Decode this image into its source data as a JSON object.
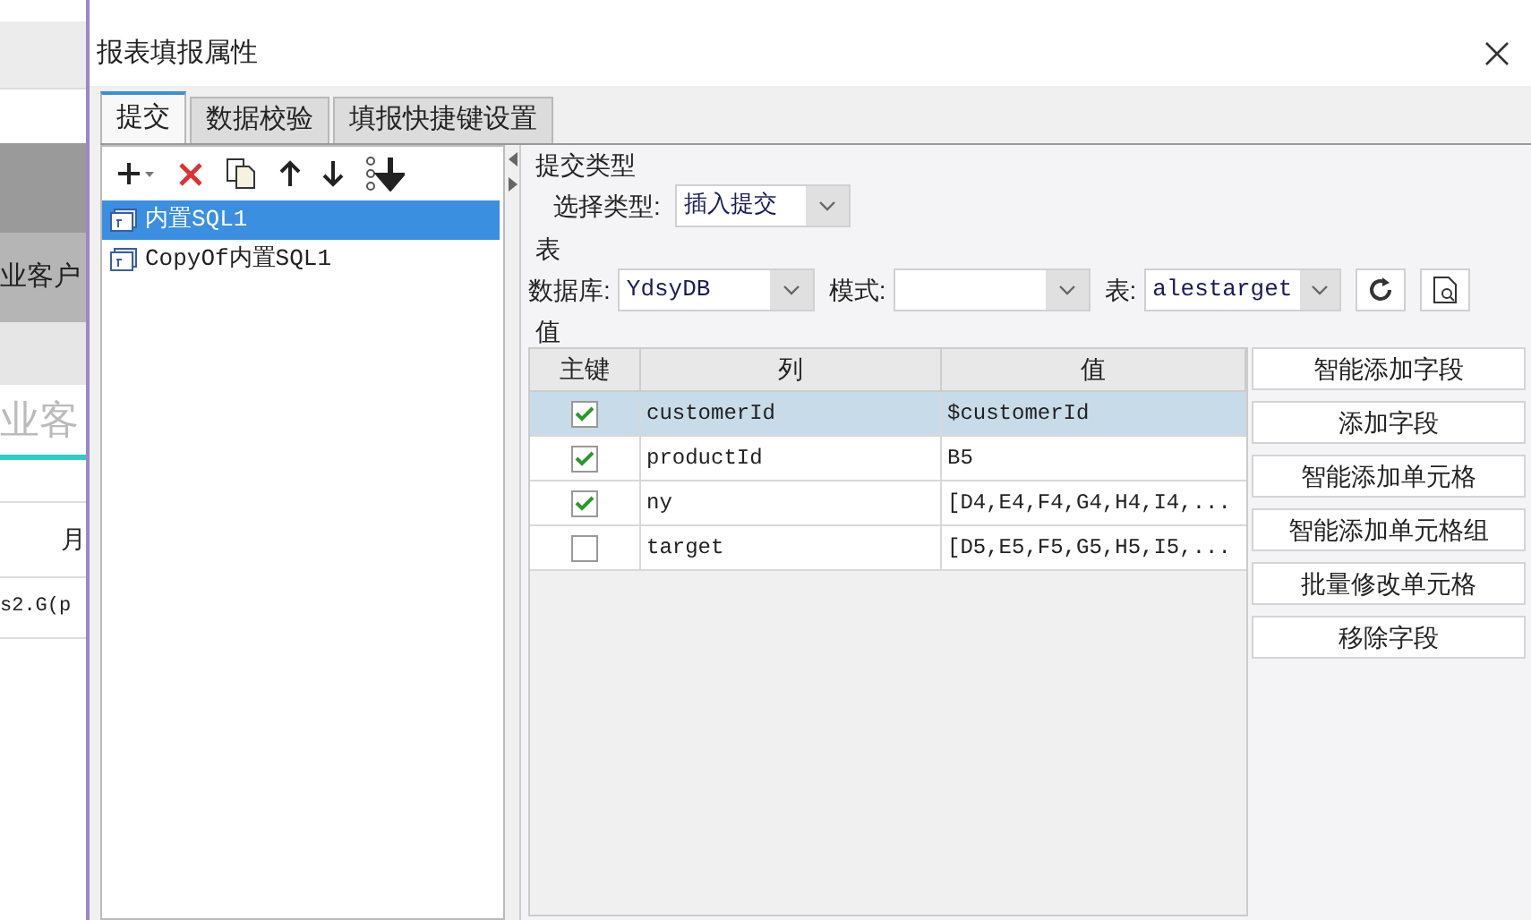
{
  "background": {
    "texts": [
      "业客户",
      "业客",
      "月",
      "s2.G(p"
    ]
  },
  "window": {
    "title": "报表填报属性"
  },
  "tabs": [
    {
      "label": "提交",
      "selected": true
    },
    {
      "label": "数据校验",
      "selected": false
    },
    {
      "label": "填报快捷键设置",
      "selected": false
    }
  ],
  "submissions": [
    {
      "label": "内置SQL1",
      "selected": true
    },
    {
      "label": "CopyOf内置SQL1",
      "selected": false
    }
  ],
  "submit_type": {
    "section": "提交类型",
    "label": "选择类型:",
    "value": "插入提交"
  },
  "table_section": {
    "section": "表",
    "database_label": "数据库:",
    "database": "YdsyDB",
    "schema_label": "模式:",
    "table_label": "表:",
    "table": "alestarget"
  },
  "values_section": {
    "section": "值",
    "columns": [
      "主键",
      "列",
      "值"
    ],
    "rows": [
      {
        "key": true,
        "column": "customerId",
        "value": "$customerId",
        "selected": true
      },
      {
        "key": true,
        "column": "productId",
        "value": "B5",
        "selected": false
      },
      {
        "key": true,
        "column": "ny",
        "value": "[D4,E4,F4,G4,H4,I4,...",
        "selected": false
      },
      {
        "key": false,
        "column": "target",
        "value": "[D5,E5,F5,G5,H5,I5,...",
        "selected": false
      }
    ]
  },
  "buttons": [
    "智能添加字段",
    "添加字段",
    "智能添加单元格",
    "智能添加单元格组",
    "批量修改单元格",
    "移除字段"
  ]
}
